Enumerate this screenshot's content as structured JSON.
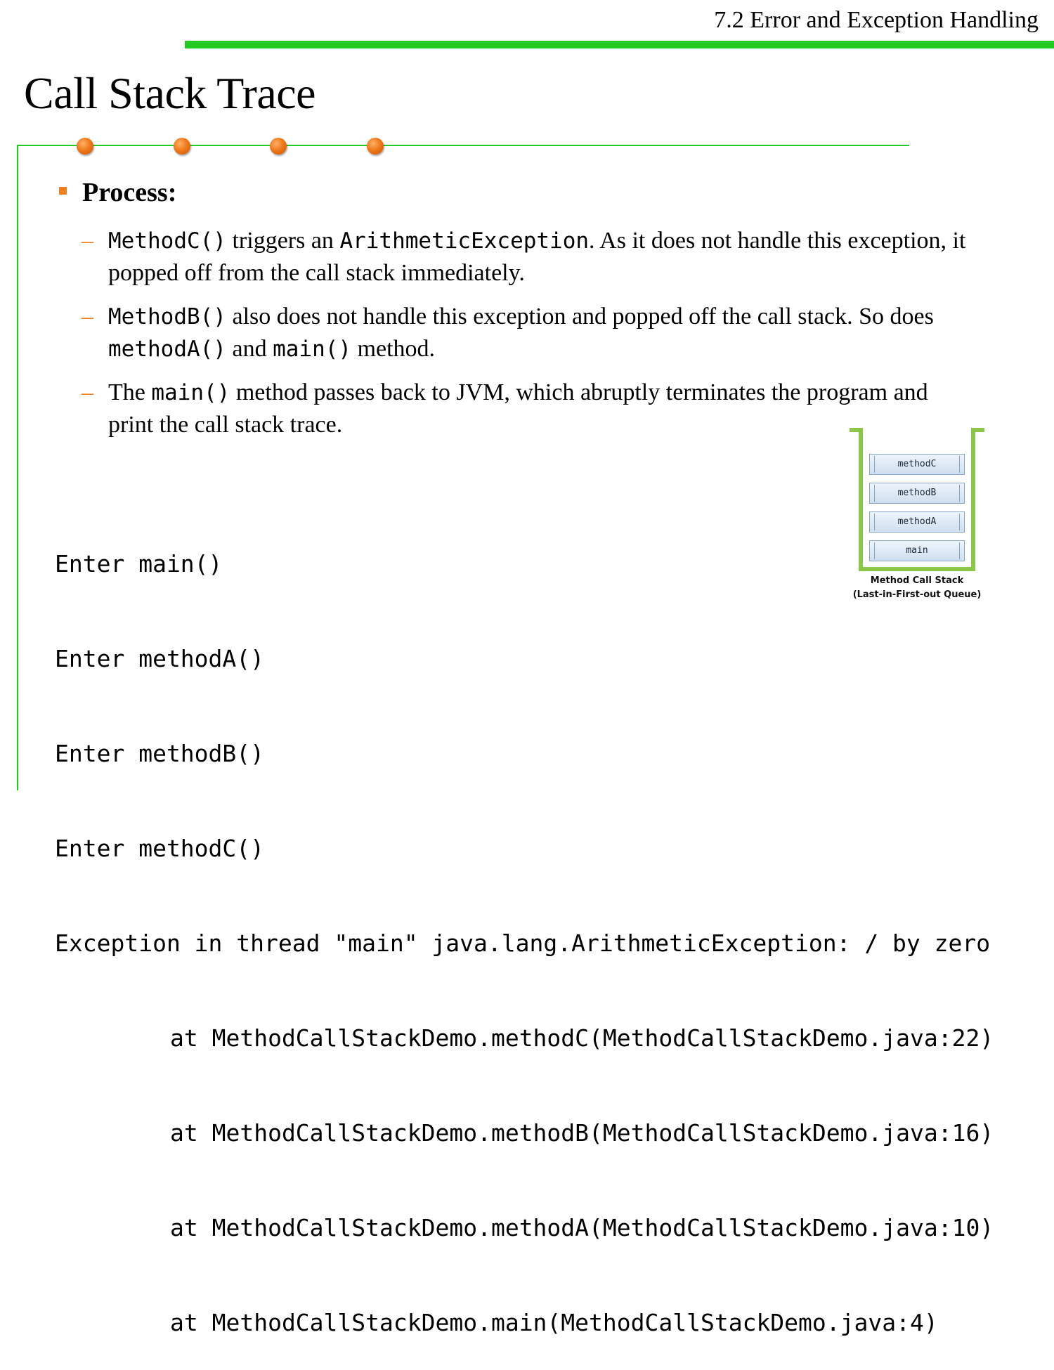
{
  "header": {
    "section": "7.2 Error and Exception Handling"
  },
  "slide": {
    "title": "Call Stack Trace"
  },
  "bullet": {
    "heading": "Process:"
  },
  "subpoints": [
    {
      "dash": "–",
      "seg1_code": "MethodC()",
      "seg2": " triggers an ",
      "seg3_code": "ArithmeticException",
      "seg4": ". As it does not handle this exception, it popped off from the call stack immediately."
    },
    {
      "dash": "–",
      "seg1_code": "MethodB()",
      "seg2": " also does not handle this exception and popped off the call stack. So does ",
      "seg3_code": "methodA()",
      "seg4": " and ",
      "seg5_code": "main()",
      "seg6": " method."
    },
    {
      "dash": "–",
      "seg1": "The ",
      "seg2_code": "main()",
      "seg3": " method passes back to JVM, which abruptly terminates the program and print the call stack trace."
    }
  ],
  "console": {
    "lines": [
      "Enter main()",
      "Enter methodA()",
      "Enter methodB()",
      "Enter methodC()",
      "Exception in thread \"main\" java.lang.ArithmeticException: / by zero"
    ],
    "trace": [
      "at MethodCallStackDemo.methodC(MethodCallStackDemo.java:22)",
      "at MethodCallStackDemo.methodB(MethodCallStackDemo.java:16)",
      "at MethodCallStackDemo.methodA(MethodCallStackDemo.java:10)",
      "at MethodCallStackDemo.main(MethodCallStackDemo.java:4)"
    ]
  },
  "stack_diagram": {
    "frames": [
      "methodC",
      "methodB",
      "methodA",
      "main"
    ],
    "caption_line1": "Method Call Stack",
    "caption_line2": "(Last-in-First-out Queue)"
  },
  "colors": {
    "accent_green": "#22cc22",
    "accent_orange": "#f07f22",
    "stack_green": "#8ec64a"
  }
}
